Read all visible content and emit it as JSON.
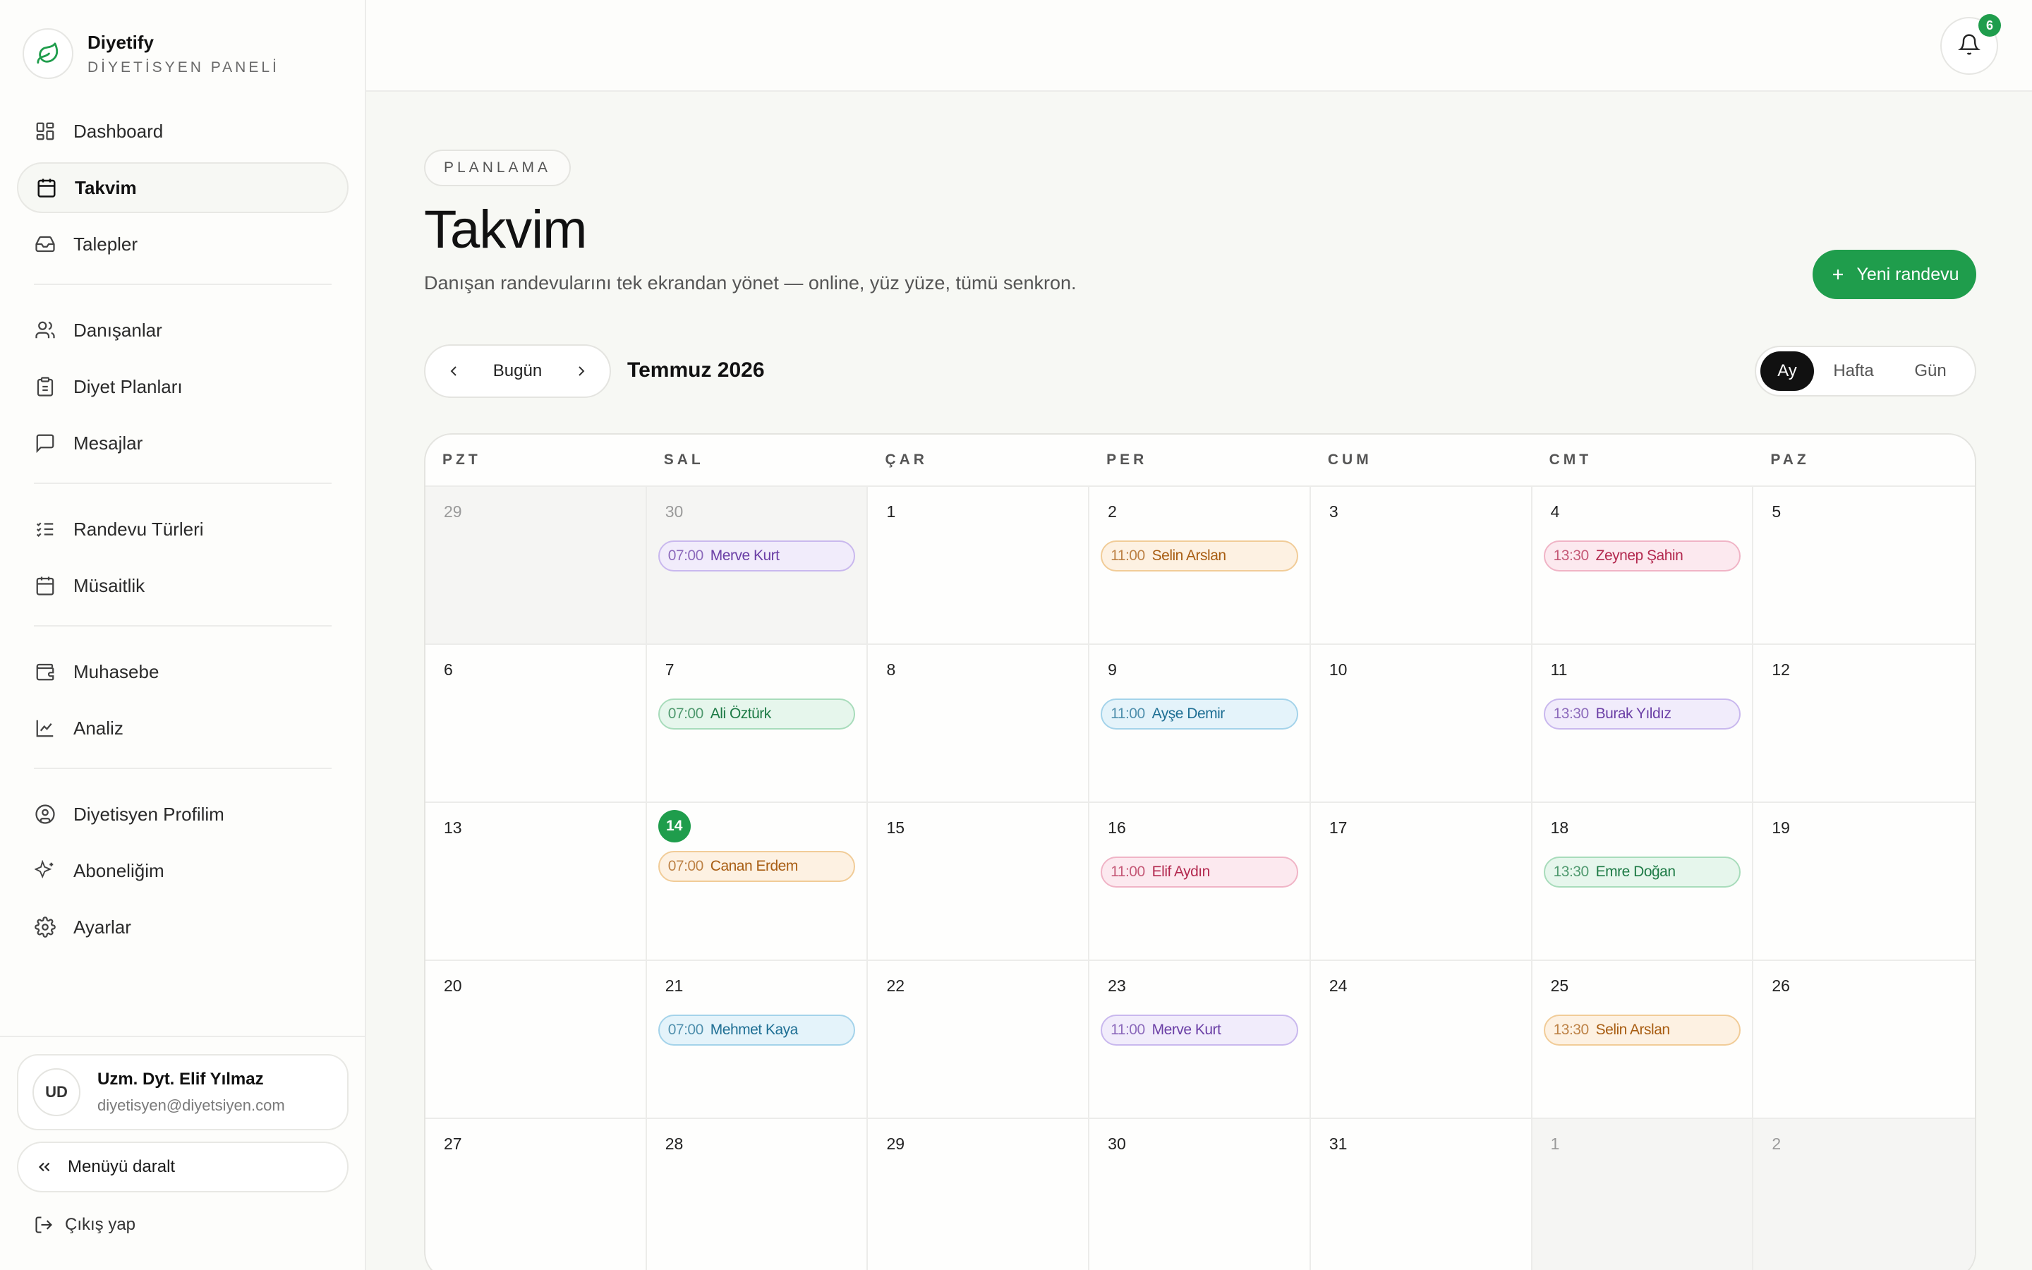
{
  "brand": {
    "name": "Diyetify",
    "subtitle": "DİYETİSYEN PANELİ"
  },
  "sidebar": {
    "items": [
      {
        "label": "Dashboard",
        "icon": "dashboard-icon"
      },
      {
        "label": "Takvim",
        "icon": "calendar-icon",
        "active": true
      },
      {
        "label": "Talepler",
        "icon": "inbox-icon"
      },
      {
        "label": "Danışanlar",
        "icon": "users-icon"
      },
      {
        "label": "Diyet Planları",
        "icon": "clipboard-icon"
      },
      {
        "label": "Mesajlar",
        "icon": "message-icon"
      },
      {
        "label": "Randevu Türleri",
        "icon": "list-check-icon"
      },
      {
        "label": "Müsaitlik",
        "icon": "calendar-days-icon"
      },
      {
        "label": "Muhasebe",
        "icon": "wallet-icon"
      },
      {
        "label": "Analiz",
        "icon": "chart-line-icon"
      },
      {
        "label": "Diyetisyen Profilim",
        "icon": "user-circle-icon"
      },
      {
        "label": "Aboneliğim",
        "icon": "sparkles-icon"
      },
      {
        "label": "Ayarlar",
        "icon": "gear-icon"
      }
    ],
    "user": {
      "initials": "UD",
      "name": "Uzm. Dyt. Elif Yılmaz",
      "email": "diyetisyen@diyetsiyen.com"
    },
    "collapse_label": "Menüyü daralt",
    "logout_label": "Çıkış yap"
  },
  "topbar": {
    "notification_count": "6"
  },
  "page": {
    "eyebrow": "PLANLAMA",
    "title": "Takvim",
    "description": "Danışan randevularını tek ekrandan yönet — online, yüz yüze, tümü senkron.",
    "new_button": "Yeni randevu"
  },
  "toolbar": {
    "today_label": "Bugün",
    "month_label": "Temmuz 2026",
    "views": [
      "Ay",
      "Hafta",
      "Gün"
    ],
    "active_view": "Ay"
  },
  "calendar": {
    "weekdays": [
      "PZT",
      "SAL",
      "ÇAR",
      "PER",
      "CUM",
      "CMT",
      "PAZ"
    ],
    "weeks": [
      [
        {
          "day": "29",
          "out": true,
          "events": []
        },
        {
          "day": "30",
          "out": true,
          "events": [
            {
              "time": "07:00",
              "name": "Merve Kurt",
              "color": "purple"
            }
          ]
        },
        {
          "day": "1",
          "events": []
        },
        {
          "day": "2",
          "events": [
            {
              "time": "11:00",
              "name": "Selin Arslan",
              "color": "orange"
            }
          ]
        },
        {
          "day": "3",
          "events": []
        },
        {
          "day": "4",
          "events": [
            {
              "time": "13:30",
              "name": "Zeynep Şahin",
              "color": "pink"
            }
          ]
        },
        {
          "day": "5",
          "events": []
        }
      ],
      [
        {
          "day": "6",
          "events": []
        },
        {
          "day": "7",
          "events": [
            {
              "time": "07:00",
              "name": "Ali Öztürk",
              "color": "green"
            }
          ]
        },
        {
          "day": "8",
          "events": []
        },
        {
          "day": "9",
          "events": [
            {
              "time": "11:00",
              "name": "Ayşe Demir",
              "color": "blue"
            }
          ]
        },
        {
          "day": "10",
          "events": []
        },
        {
          "day": "11",
          "events": [
            {
              "time": "13:30",
              "name": "Burak Yıldız",
              "color": "purple"
            }
          ]
        },
        {
          "day": "12",
          "events": []
        }
      ],
      [
        {
          "day": "13",
          "events": []
        },
        {
          "day": "14",
          "today": true,
          "events": [
            {
              "time": "07:00",
              "name": "Canan Erdem",
              "color": "orange"
            }
          ]
        },
        {
          "day": "15",
          "events": []
        },
        {
          "day": "16",
          "events": [
            {
              "time": "11:00",
              "name": "Elif Aydın",
              "color": "pink"
            }
          ]
        },
        {
          "day": "17",
          "events": []
        },
        {
          "day": "18",
          "events": [
            {
              "time": "13:30",
              "name": "Emre Doğan",
              "color": "green"
            }
          ]
        },
        {
          "day": "19",
          "events": []
        }
      ],
      [
        {
          "day": "20",
          "events": []
        },
        {
          "day": "21",
          "events": [
            {
              "time": "07:00",
              "name": "Mehmet Kaya",
              "color": "blue"
            }
          ]
        },
        {
          "day": "22",
          "events": []
        },
        {
          "day": "23",
          "events": [
            {
              "time": "11:00",
              "name": "Merve Kurt",
              "color": "purple"
            }
          ]
        },
        {
          "day": "24",
          "events": []
        },
        {
          "day": "25",
          "events": [
            {
              "time": "13:30",
              "name": "Selin Arslan",
              "color": "orange"
            }
          ]
        },
        {
          "day": "26",
          "events": []
        }
      ],
      [
        {
          "day": "27",
          "events": []
        },
        {
          "day": "28",
          "events": []
        },
        {
          "day": "29",
          "events": []
        },
        {
          "day": "30",
          "events": []
        },
        {
          "day": "31",
          "events": []
        },
        {
          "day": "1",
          "out": true,
          "events": []
        },
        {
          "day": "2",
          "out": true,
          "events": []
        }
      ]
    ]
  },
  "colors": {
    "accent": "#1f9d4c",
    "purple": {
      "bg": "#f1ecfb",
      "border": "#c9b8ee",
      "text": "#6b3fa6"
    },
    "orange": {
      "bg": "#fdf1e2",
      "border": "#f1cc98",
      "text": "#a85d12"
    },
    "pink": {
      "bg": "#fce9ef",
      "border": "#f0b4c6",
      "text": "#b3294f"
    },
    "green": {
      "bg": "#e6f6ec",
      "border": "#a8dcbb",
      "text": "#1d7a45"
    },
    "blue": {
      "bg": "#e4f3fa",
      "border": "#a4d3ea",
      "text": "#1f6f94"
    }
  }
}
